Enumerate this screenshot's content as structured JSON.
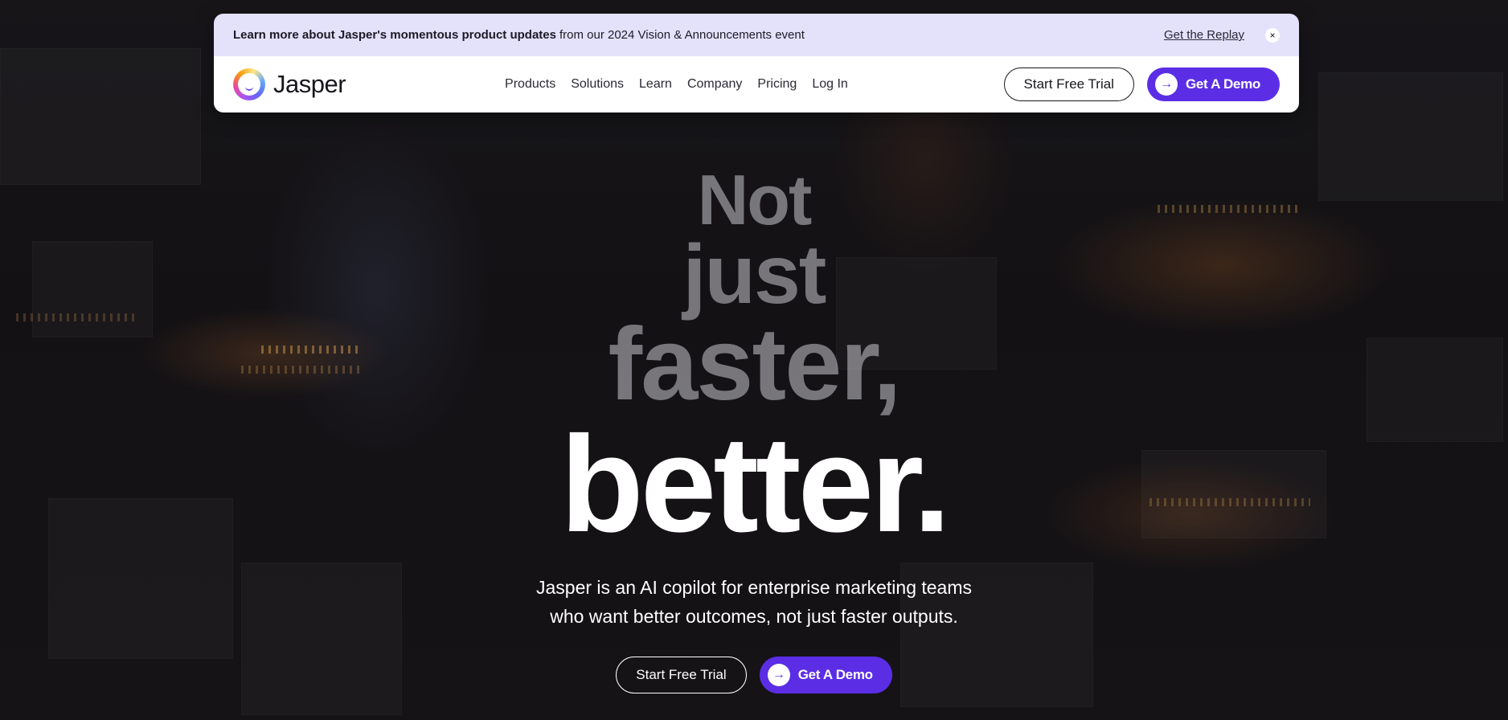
{
  "announcement": {
    "bold_text": "Learn more about Jasper's momentous product updates",
    "text": "from our 2024 Vision & Announcements event",
    "link": "Get the Replay",
    "close_icon": "×"
  },
  "brand": {
    "name": "Jasper"
  },
  "nav": {
    "items": [
      {
        "label": "Products"
      },
      {
        "label": "Solutions"
      },
      {
        "label": "Learn"
      },
      {
        "label": "Company"
      },
      {
        "label": "Pricing"
      },
      {
        "label": "Log In"
      }
    ],
    "trial_label": "Start Free Trial",
    "demo_label": "Get A Demo",
    "arrow_icon": "→"
  },
  "hero": {
    "line1": "Not",
    "line2": "just",
    "line3": "faster,",
    "line4": "better.",
    "subtitle_line1": "Jasper is an AI copilot for enterprise marketing teams",
    "subtitle_line2": "who want better outcomes, not just faster outputs.",
    "trial_label": "Start Free Trial",
    "demo_label": "Get A Demo"
  },
  "colors": {
    "accent": "#5b2ee6",
    "announcement_bg": "#e4e1fb"
  }
}
